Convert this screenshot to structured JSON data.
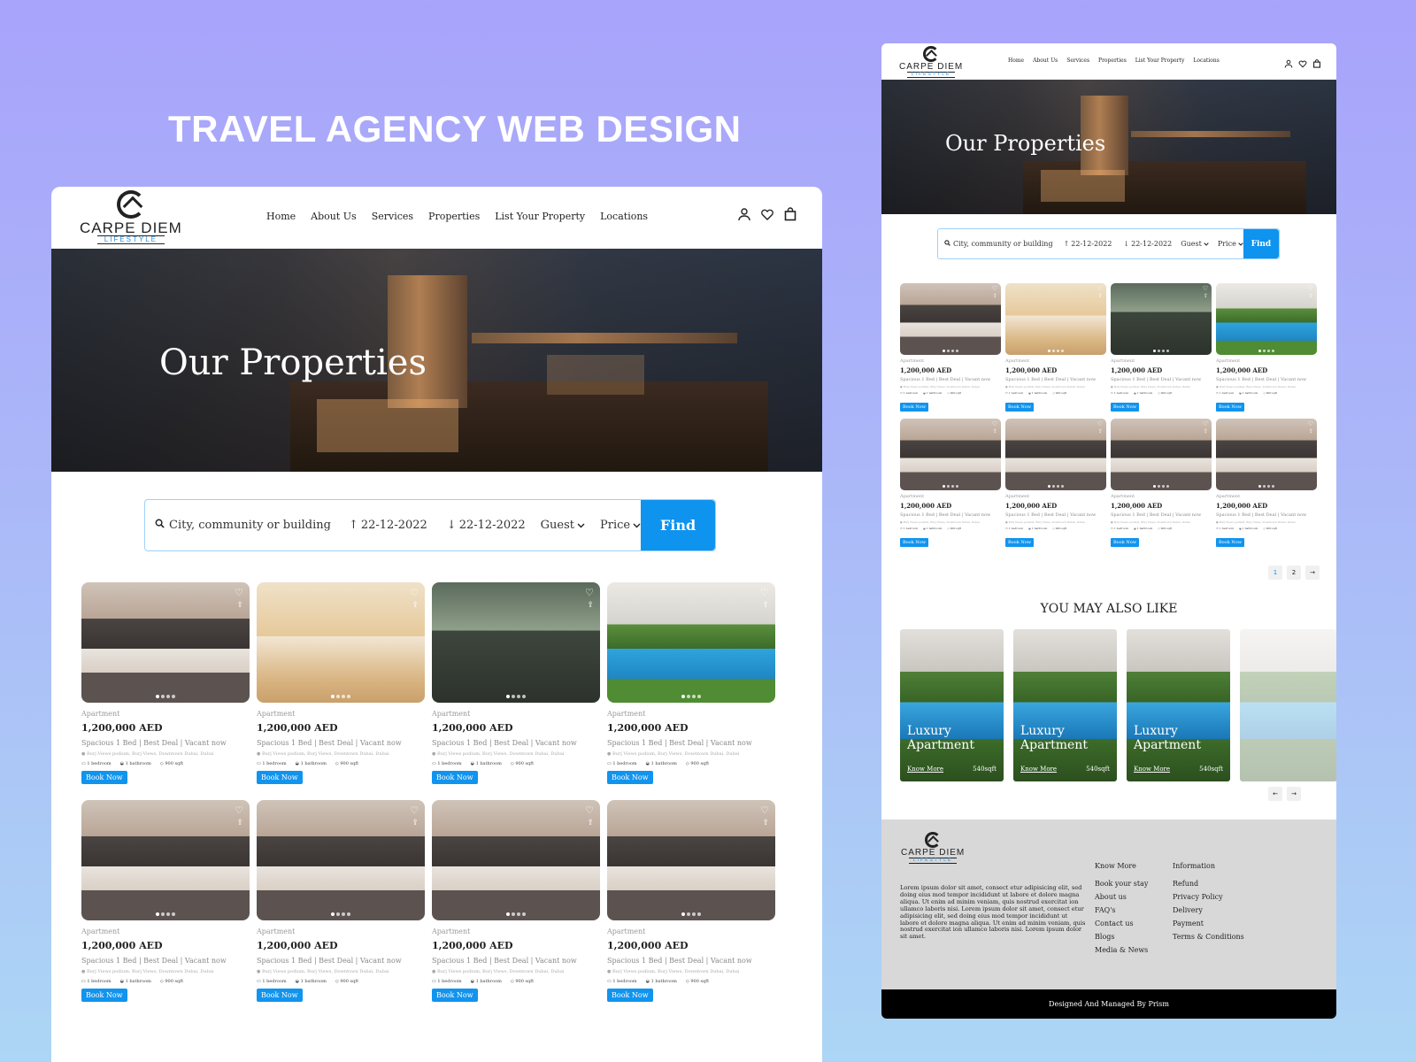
{
  "headline": "TRAVEL AGENCY WEB DESIGN",
  "brand": {
    "name": "CARPE DIEM",
    "sub": "LIFESTYLE",
    "accent": "#1194ee"
  },
  "nav": {
    "links": [
      "Home",
      "About Us",
      "Services",
      "Properties",
      "List Your Property",
      "Locations"
    ],
    "icons": [
      "user-icon",
      "heart-icon",
      "shopping-bag-icon"
    ]
  },
  "hero": {
    "title": "Our Properties"
  },
  "search": {
    "placeholder": "City, community or building",
    "checkin": "22-12-2022",
    "checkout": "22-12-2022",
    "guest": "Guest",
    "price": "Price",
    "find": "Find"
  },
  "listing_card": {
    "type": "Apartment",
    "price": "1,200,000 AED",
    "desc": "Spacious 1 Bed | Best Deal | Vacant now",
    "addr": "Burj Views podium, Burj Views, Downtown Dubai, Dubai",
    "bedrooms": "1 bedroom",
    "bathrooms": "1 bathroom",
    "area": "900 sqft",
    "book": "Book Now"
  },
  "listings": [
    {
      "image": "bedroom"
    },
    {
      "image": "living"
    },
    {
      "image": "office"
    },
    {
      "image": "pool"
    },
    {
      "image": "bedroom"
    },
    {
      "image": "bedroom"
    },
    {
      "image": "bedroom"
    },
    {
      "image": "bedroom"
    }
  ],
  "pagination": {
    "pages": [
      "1",
      "2"
    ],
    "current_page": "1",
    "next": "→"
  },
  "also_like": {
    "title": "YOU MAY ALSO LIKE",
    "card_title_line1": "Luxury",
    "card_title_line2": "Apartment",
    "know_more": "Know More",
    "size": "540sqft",
    "count_visible": 3,
    "prev": "←",
    "next": "→"
  },
  "footer": {
    "lorem": "Lorem ipsum dolor sit amet, consect etur adipisicing elit, sed doing eius mod tempor incididunt ut labore et dolore magna aliqua. Ut enim ad minim veniam, quis nostrud exercitat ion ullamco laboris nisi. Lorem ipsum dolor sit amet, consect etur adipisicing elit, sed doing eius mod tempor incididunt ut labore et dolore magna aliqua. Ut enim ad minim veniam, quis nostrud exercitat ion ullamco laboris nisi. Lorem ipsum dolor sit amet.",
    "col1": {
      "head": "Know More",
      "items": [
        "Book your stay",
        "About us",
        "FAQ's",
        "Contact us",
        "Blogs",
        "Media & News"
      ]
    },
    "col2": {
      "head": "Information",
      "items": [
        "Refund",
        "Privacy Policy",
        "Delivery",
        "Payment",
        "Terms & Conditions"
      ]
    },
    "credit": "Designed And Managed By Prism"
  }
}
